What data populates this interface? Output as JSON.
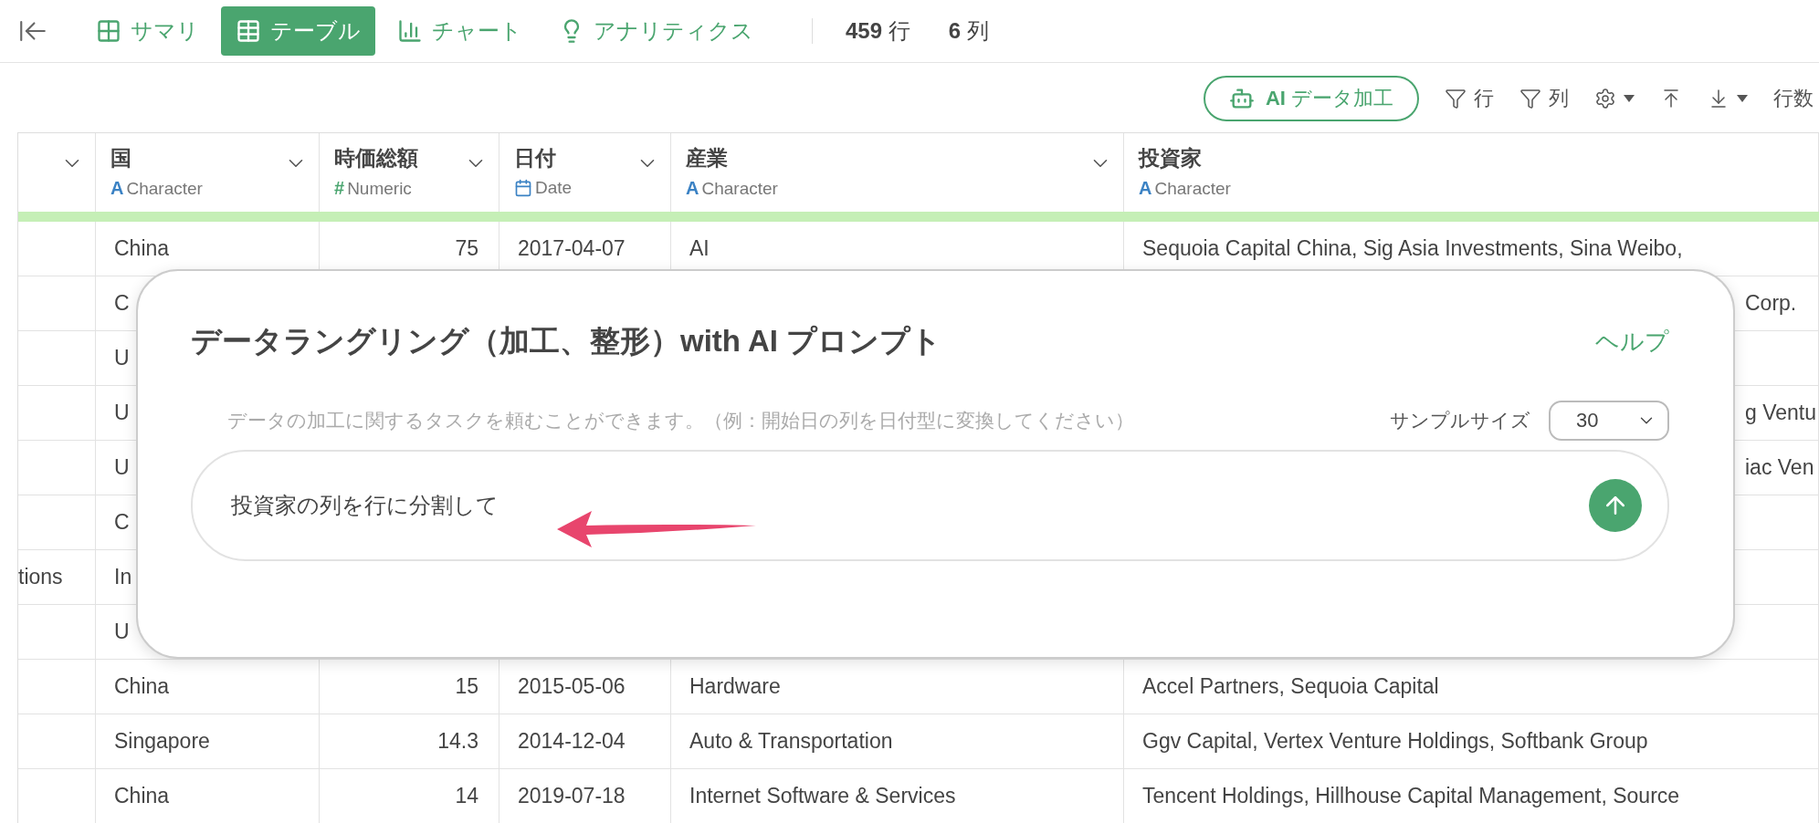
{
  "view_tabs": [
    {
      "kind": "summary",
      "label": "サマリ",
      "selected": false
    },
    {
      "kind": "table",
      "label": "テーブル",
      "selected": true
    },
    {
      "kind": "chart",
      "label": "チャート",
      "selected": false
    },
    {
      "kind": "analytics",
      "label": "アナリティクス",
      "selected": false
    }
  ],
  "counts": [
    "**459** 行",
    "**6** 列"
  ],
  "toolbar": {
    "ai_button": "**AI** データ加工",
    "filter_rows": "行",
    "filter_columns": "列",
    "row_count": "行数"
  },
  "table": {
    "columns": [
      {
        "kind": "blank"
      },
      {
        "name": "国",
        "kind": "character",
        "type_mark": "A",
        "type": "Character"
      },
      {
        "name": "時価総額",
        "kind": "numeric",
        "type_mark": "#",
        "type": "Numeric"
      },
      {
        "name": "日付",
        "kind": "date",
        "type": "Date"
      },
      {
        "name": "産業",
        "kind": "character",
        "type_mark": "A",
        "type": "Character"
      },
      {
        "name": "投資家",
        "kind": "character",
        "type_mark": "A",
        "type": "Character"
      }
    ],
    "rows": [
      {
        "kind": "full",
        "cells": [
          "",
          "China",
          "75",
          "2017-04-07",
          "AI",
          "Sequoia Capital China, Sig Asia Investments, Sina Weibo,"
        ]
      },
      {
        "kind": "covered",
        "cells": [
          "",
          "C",
          "",
          "",
          "",
          "Corp."
        ]
      },
      {
        "kind": "covered",
        "cells": [
          "",
          "U",
          "",
          "",
          "",
          ""
        ]
      },
      {
        "kind": "covered",
        "cells": [
          "",
          "U",
          "",
          "",
          "",
          "g Ventu"
        ]
      },
      {
        "kind": "covered",
        "cells": [
          "",
          "U",
          "",
          "",
          "",
          "iac Ven"
        ]
      },
      {
        "kind": "covered",
        "cells": [
          "",
          "C",
          "",
          "",
          "",
          ""
        ]
      },
      {
        "kind": "covered",
        "cells": [
          "tions",
          "In",
          "",
          "",
          "",
          ""
        ]
      },
      {
        "kind": "covered",
        "cells": [
          "",
          "U",
          "",
          "",
          "",
          ""
        ]
      },
      {
        "kind": "full",
        "cells": [
          "",
          "China",
          "15",
          "2015-05-06",
          "Hardware",
          "Accel Partners, Sequoia Capital"
        ]
      },
      {
        "kind": "full",
        "cells": [
          "",
          "Singapore",
          "14.3",
          "2014-12-04",
          "Auto & Transportation",
          "Ggv Capital, Vertex Venture Holdings, Softbank Group"
        ]
      },
      {
        "kind": "full",
        "cells": [
          "",
          "China",
          "14",
          "2019-07-18",
          "Internet Software & Services",
          "Tencent Holdings, Hillhouse Capital Management, Source"
        ]
      }
    ]
  },
  "dialog": {
    "title": "データラングリング（加工、整形）with AI プロンプト",
    "help": "ヘルプ",
    "hint": "データの加工に関するタスクを頼むことができます。（例：開始日の列を日付型に変換してください）",
    "sample_size_label": "サンプルサイズ",
    "sample_size": "30",
    "prompt": "投資家の列を行に分割して"
  }
}
